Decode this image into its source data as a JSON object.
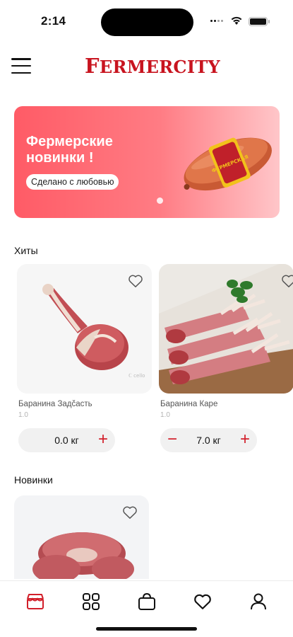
{
  "status_bar": {
    "time": "2:14"
  },
  "header": {
    "logo_text": "Fermercity"
  },
  "banner": {
    "title": "Фермерские новинки !",
    "subtitle": "Сделано с любовью",
    "package_label": "ФЕРМЕРСКАЯ",
    "colors": {
      "start": "#ff5b66",
      "end": "#ffc6c9"
    }
  },
  "sections": {
    "hits_title": "Хиты",
    "new_title": "Новинки"
  },
  "hits": [
    {
      "name": "Баранина Задčасть",
      "sub": "1.0",
      "qty": "0.0 кг",
      "minus": "",
      "plus": "+",
      "watermark": "ℂ cello"
    },
    {
      "name": "Баранина Каре",
      "sub": "1.0",
      "qty": "7.0 кг",
      "minus": "−",
      "plus": "+"
    }
  ],
  "tabs": [
    "shop-icon",
    "grid-icon",
    "bag-icon",
    "heart-icon",
    "profile-icon"
  ],
  "colors": {
    "accent": "#d21f2a",
    "logo": "#c8141f"
  }
}
